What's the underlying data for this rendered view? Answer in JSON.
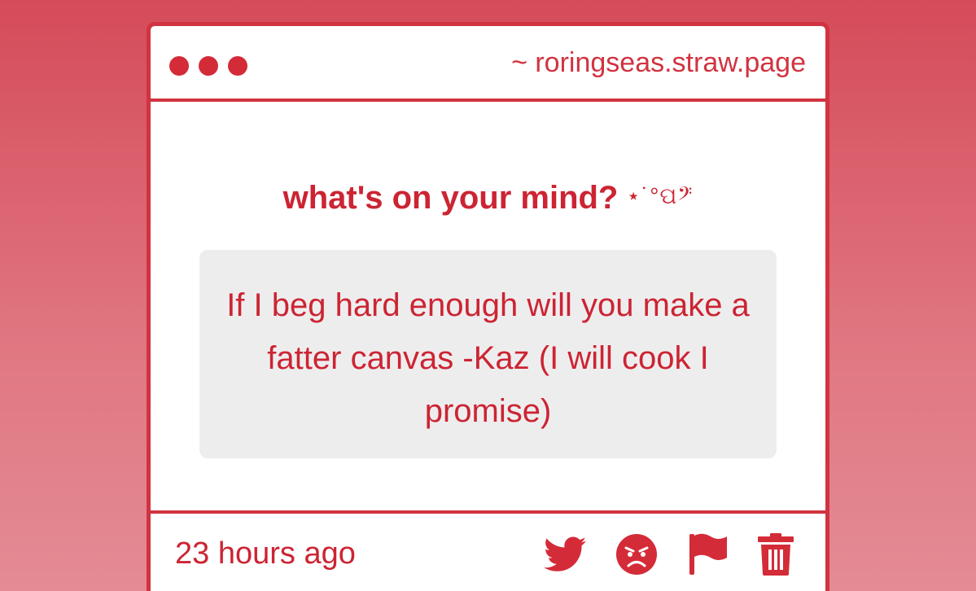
{
  "window": {
    "url": "~ roringseas.straw.page"
  },
  "prompt": {
    "text": "what's on your mind?",
    "decoration": "⋆˙°ପ𝄢"
  },
  "message": {
    "text": "If I beg hard enough will you make a fatter canvas -Kaz (I will cook I promise)"
  },
  "footer": {
    "timestamp": "23 hours ago",
    "actions": [
      "twitter-icon",
      "angry-face-icon",
      "flag-icon",
      "trash-icon"
    ]
  },
  "colors": {
    "accent": "#d13340",
    "text": "#cc2433",
    "message_background": "#eeedee"
  }
}
